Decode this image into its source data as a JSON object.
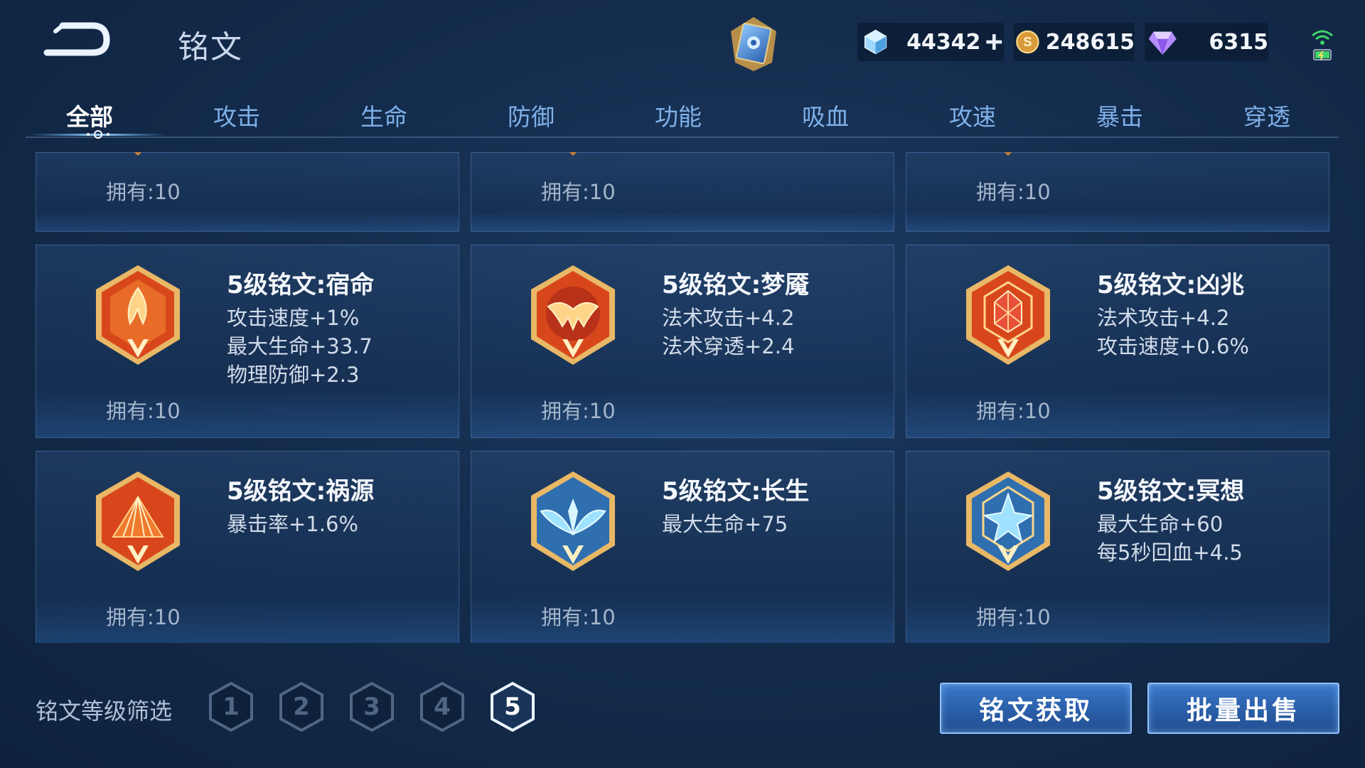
{
  "header": {
    "title": "铭文",
    "currencies": {
      "coupon": {
        "value": "44342",
        "icon": "diamond-coupon-icon",
        "add_icon": "plus-icon"
      },
      "gold": {
        "value": "248615",
        "icon": "gold-coin-icon"
      },
      "gem": {
        "value": "6315",
        "icon": "purple-gem-icon"
      }
    }
  },
  "tabs": [
    {
      "label": "全部",
      "active": true
    },
    {
      "label": "攻击"
    },
    {
      "label": "生命"
    },
    {
      "label": "防御"
    },
    {
      "label": "功能"
    },
    {
      "label": "吸血"
    },
    {
      "label": "攻速"
    },
    {
      "label": "暴击"
    },
    {
      "label": "穿透"
    }
  ],
  "top_row_owned": [
    "拥有:10",
    "拥有:10",
    "拥有:10"
  ],
  "runes": [
    {
      "name": "5级铭文:宿命",
      "stats": [
        "攻击速度+1%",
        "最大生命+33.7",
        "物理防御+2.3"
      ],
      "owned": "拥有:10",
      "color": "red",
      "icon": "flame-rune-icon"
    },
    {
      "name": "5级铭文:梦魇",
      "stats": [
        "法术攻击+4.2",
        "法术穿透+2.4"
      ],
      "owned": "拥有:10",
      "color": "red",
      "icon": "nightmare-rune-icon"
    },
    {
      "name": "5级铭文:凶兆",
      "stats": [
        "法术攻击+4.2",
        "攻击速度+0.6%"
      ],
      "owned": "拥有:10",
      "color": "red",
      "icon": "omen-rune-icon"
    },
    {
      "name": "5级铭文:祸源",
      "stats": [
        "暴击率+1.6%"
      ],
      "owned": "拥有:10",
      "color": "red",
      "icon": "fan-rune-icon"
    },
    {
      "name": "5级铭文:长生",
      "stats": [
        "最大生命+75"
      ],
      "owned": "拥有:10",
      "color": "blue",
      "icon": "wings-rune-icon"
    },
    {
      "name": "5级铭文:冥想",
      "stats": [
        "最大生命+60",
        "每5秒回血+4.5"
      ],
      "owned": "拥有:10",
      "color": "blue",
      "icon": "crystal-rune-icon"
    }
  ],
  "filter": {
    "label": "铭文等级筛选",
    "levels": [
      "1",
      "2",
      "3",
      "4",
      "5"
    ],
    "selected": "5"
  },
  "actions": {
    "get_label": "铭文获取",
    "sell_label": "批量出售"
  },
  "colors": {
    "red_rune": "#d8471c",
    "blue_rune": "#2f6fb0",
    "gold_trim": "#e8b866",
    "tab_inactive": "#7fb0e8",
    "button_border": "#8fc3ff"
  }
}
